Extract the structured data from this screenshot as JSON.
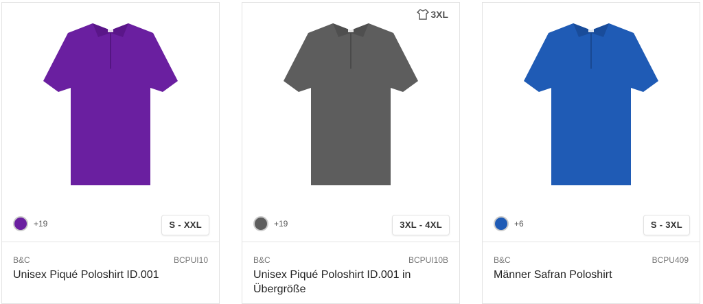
{
  "products": [
    {
      "brand": "B&C",
      "sku": "BCPUI10",
      "title": "Unisex Piqué Poloshirt ID.001",
      "color_hex": "#6a1fa0",
      "more_colors": "+19",
      "size_range": "S - XXL",
      "plus_size_badge": null
    },
    {
      "brand": "B&C",
      "sku": "BCPUI10B",
      "title": "Unisex Piqué Poloshirt ID.001 in Übergröße",
      "color_hex": "#5d5d5d",
      "more_colors": "+19",
      "size_range": "3XL - 4XL",
      "plus_size_badge": "3XL"
    },
    {
      "brand": "B&C",
      "sku": "BCPU409",
      "title": "Männer Safran Poloshirt",
      "color_hex": "#1f5bb5",
      "more_colors": "+6",
      "size_range": "S - 3XL",
      "plus_size_badge": null
    }
  ],
  "icons": {
    "plus_size": "tshirt-icon"
  }
}
